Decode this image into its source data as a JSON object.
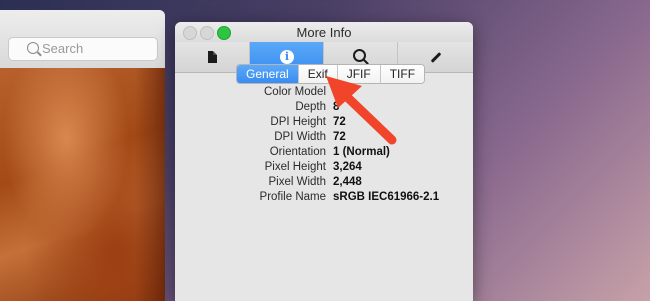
{
  "background_window": {
    "search_placeholder": "Search"
  },
  "window": {
    "title": "More Info"
  },
  "toolbar_tabs": [
    {
      "icon": "document-icon"
    },
    {
      "icon": "info-icon",
      "glyph": "i",
      "active": true
    },
    {
      "icon": "magnifier-icon"
    },
    {
      "icon": "pencil-icon"
    }
  ],
  "segments": [
    {
      "label": "General",
      "active": true
    },
    {
      "label": "Exif"
    },
    {
      "label": "JFIF"
    },
    {
      "label": "TIFF"
    }
  ],
  "properties": [
    {
      "key": "Color Model",
      "value": ""
    },
    {
      "key": "Depth",
      "value": "8"
    },
    {
      "key": "DPI Height",
      "value": "72"
    },
    {
      "key": "DPI Width",
      "value": "72"
    },
    {
      "key": "Orientation",
      "value": "1 (Normal)"
    },
    {
      "key": "Pixel Height",
      "value": "3,264"
    },
    {
      "key": "Pixel Width",
      "value": "2,448"
    },
    {
      "key": "Profile Name",
      "value": "sRGB IEC61966-2.1"
    }
  ],
  "colors": {
    "accent": "#3b8ef0",
    "arrow": "#f0452a"
  }
}
